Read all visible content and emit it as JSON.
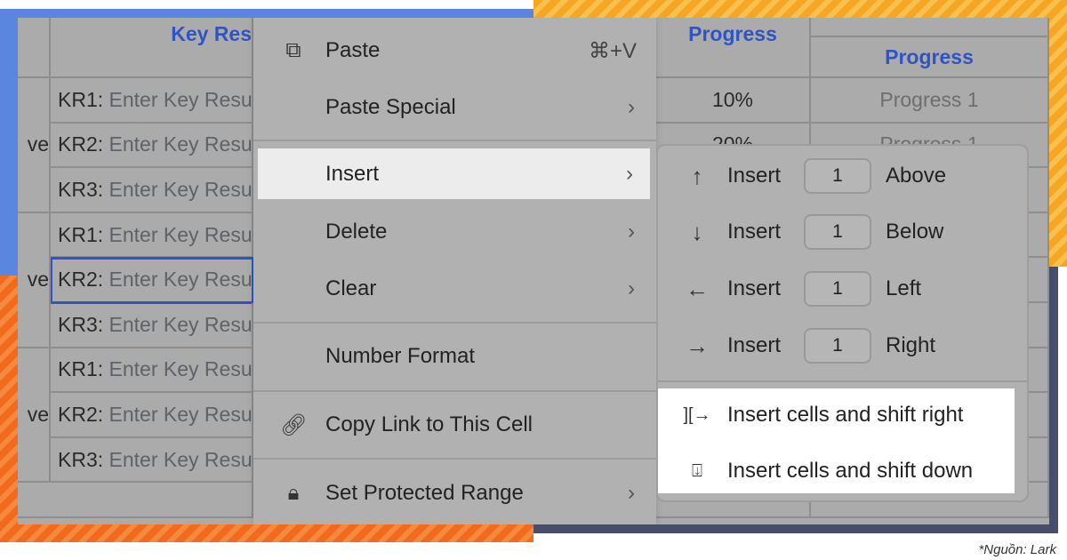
{
  "table": {
    "headers": {
      "key_results": "Key Res",
      "progress": "Progress",
      "progress2": "Progress"
    },
    "objective_fragments": [
      "ve",
      "ve",
      "ve"
    ],
    "rows": [
      {
        "kr": "KR1:",
        "placeholder": "Enter Key Resu",
        "progress": "10%",
        "progress2": "Progress 1"
      },
      {
        "kr": "KR2:",
        "placeholder": "Enter Key Resu",
        "progress": "20%",
        "progress2": "Progress 1"
      },
      {
        "kr": "KR3:",
        "placeholder": "Enter Key Resu",
        "progress": "",
        "progress2": ""
      },
      {
        "kr": "KR1:",
        "placeholder": "Enter Key Resu",
        "progress": "",
        "progress2": ""
      },
      {
        "kr": "KR2:",
        "placeholder": "Enter Key Resu",
        "progress": "",
        "progress2": ""
      },
      {
        "kr": "KR3:",
        "placeholder": "Enter Key Resu",
        "progress": "",
        "progress2": ""
      },
      {
        "kr": "KR1:",
        "placeholder": "Enter Key Resu",
        "progress": "",
        "progress2": ""
      },
      {
        "kr": "KR2:",
        "placeholder": "Enter Key Resu",
        "progress": "",
        "progress2": ""
      },
      {
        "kr": "KR3:",
        "placeholder": "Enter Key Resu",
        "progress": "",
        "progress2": ""
      }
    ]
  },
  "context_menu": {
    "paste": "Paste",
    "paste_shortcut": "⌘+V",
    "paste_special": "Paste Special",
    "insert": "Insert",
    "delete": "Delete",
    "clear": "Clear",
    "number_format": "Number Format",
    "copy_link": "Copy Link to This Cell",
    "set_protected": "Set Protected Range"
  },
  "insert_submenu": {
    "items": [
      {
        "icon": "arrow-up-icon",
        "label": "Insert",
        "count": "1",
        "direction": "Above"
      },
      {
        "icon": "arrow-down-icon",
        "label": "Insert",
        "count": "1",
        "direction": "Below"
      },
      {
        "icon": "arrow-left-icon",
        "label": "Insert",
        "count": "1",
        "direction": "Left"
      },
      {
        "icon": "arrow-right-icon",
        "label": "Insert",
        "count": "1",
        "direction": "Right"
      }
    ],
    "shift_right": "Insert cells and shift right",
    "shift_down": "Insert cells and shift down"
  },
  "source": "*Nguồn: Lark"
}
